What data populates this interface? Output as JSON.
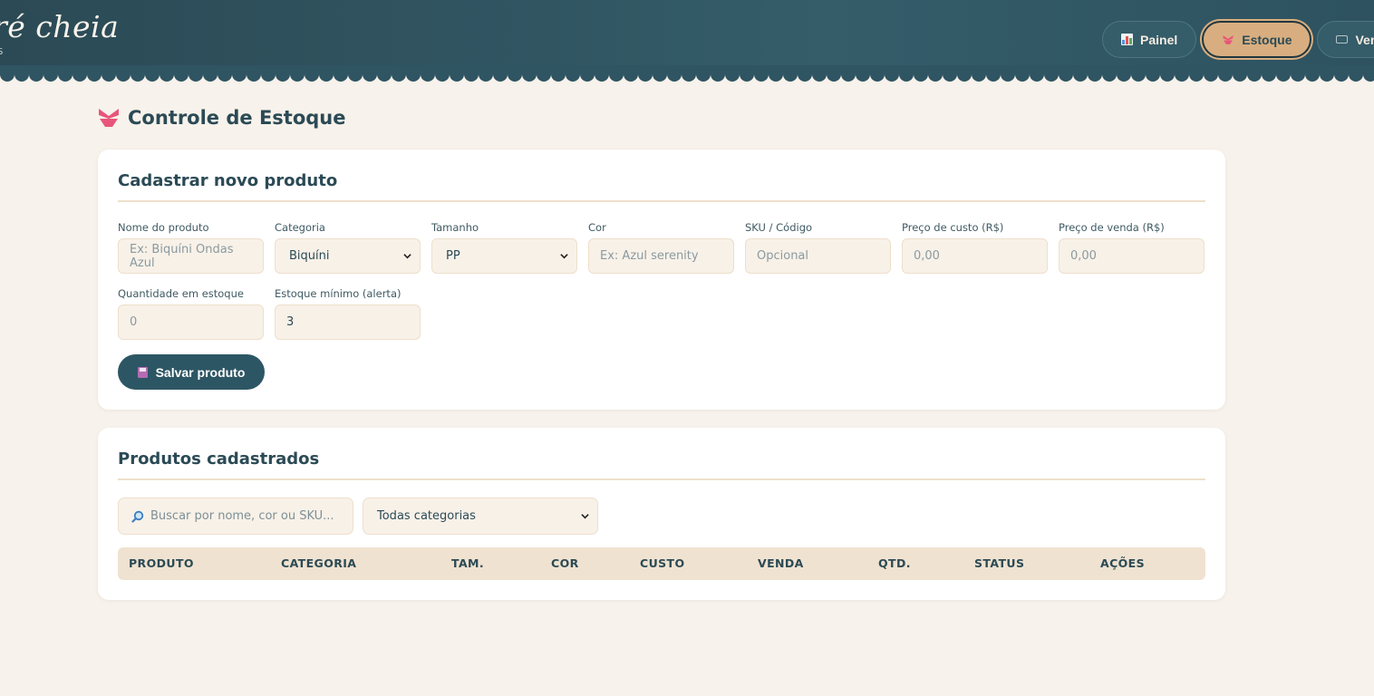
{
  "app": {
    "brand": "Maré cheia",
    "brand_visible": "ré cheia",
    "tagline_visible": "S"
  },
  "nav": {
    "items": [
      {
        "label": "Painel",
        "icon": "bar-chart-icon",
        "active": false
      },
      {
        "label": "Estoque",
        "icon": "bikini-icon",
        "active": true
      },
      {
        "label": "Vend",
        "icon": "keyboard-icon",
        "active": false
      }
    ]
  },
  "page": {
    "title": "Controle de Estoque",
    "title_icon": "bikini-icon"
  },
  "form": {
    "title": "Cadastrar novo produto",
    "fields": {
      "nome": {
        "label": "Nome do produto",
        "placeholder": "Ex: Biquíni Ondas Azul",
        "value": ""
      },
      "categoria": {
        "label": "Categoria",
        "value": "Biquíni"
      },
      "tamanho": {
        "label": "Tamanho",
        "value": "PP"
      },
      "cor": {
        "label": "Cor",
        "placeholder": "Ex: Azul serenity",
        "value": ""
      },
      "sku": {
        "label": "SKU / Código",
        "placeholder": "Opcional",
        "value": ""
      },
      "custo": {
        "label": "Preço de custo (R$)",
        "placeholder": "0,00",
        "value": ""
      },
      "venda": {
        "label": "Preço de venda (R$)",
        "placeholder": "0,00",
        "value": ""
      },
      "quantidade": {
        "label": "Quantidade em estoque",
        "placeholder": "0",
        "value": ""
      },
      "minimo": {
        "label": "Estoque mínimo (alerta)",
        "value": "3"
      }
    },
    "save_label": "Salvar produto",
    "save_icon": "floppy-disk-icon"
  },
  "products": {
    "title": "Produtos cadastrados",
    "search_placeholder": "Buscar por nome, cor ou SKU...",
    "search_icon": "magnifier-icon",
    "filter_value": "Todas categorias",
    "columns": [
      "PRODUTO",
      "CATEGORIA",
      "TAM.",
      "COR",
      "CUSTO",
      "VENDA",
      "QTD.",
      "STATUS",
      "AÇÕES"
    ],
    "rows": []
  },
  "colors": {
    "header_bg": "#2b4a55",
    "page_bg": "#f7f2eb",
    "accent": "#d8ae80",
    "primary_button": "#2d5664",
    "table_header_bg": "#f0e2d0"
  }
}
